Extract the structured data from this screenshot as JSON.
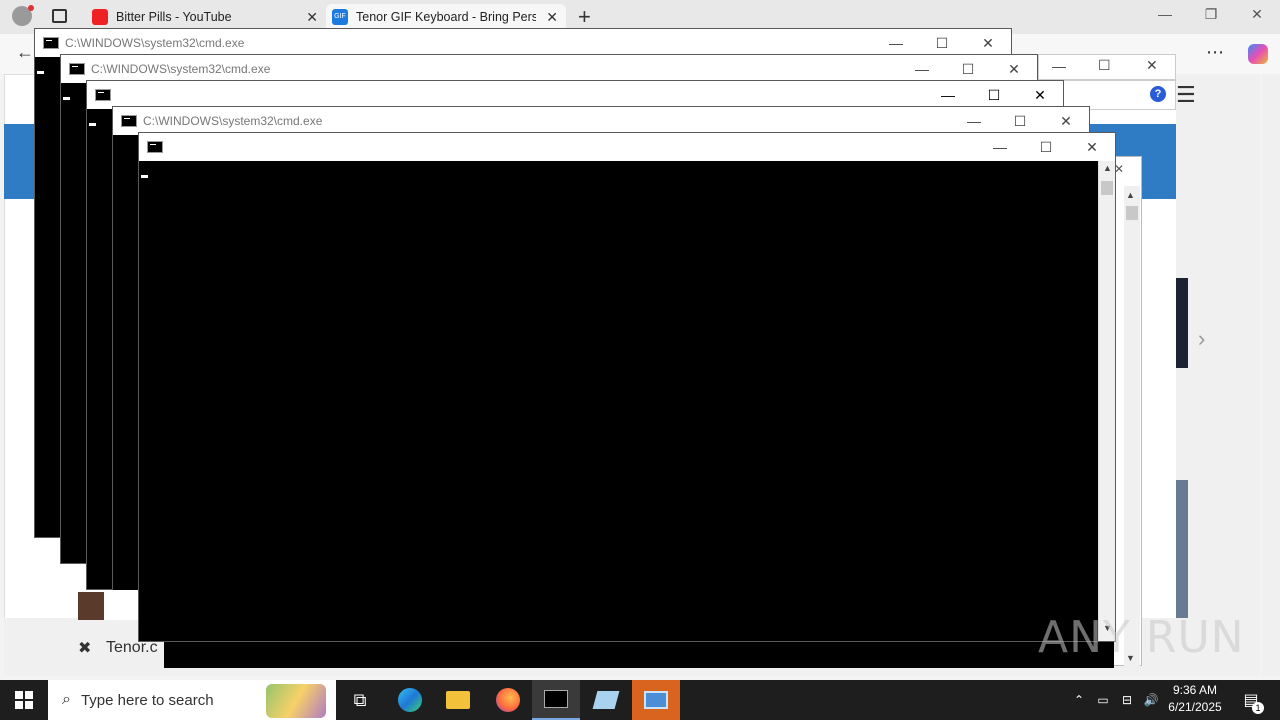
{
  "browser": {
    "tabs": [
      {
        "label": "Bitter Pills - YouTube"
      },
      {
        "label": "Tenor GIF Keyboard - Bring Perso"
      }
    ],
    "new_tab_symbol": "+",
    "bottom_tab_text": "Tenor.c"
  },
  "cmd_windows": [
    {
      "title": "C:\\WINDOWS\\system32\\cmd.exe"
    },
    {
      "title": "C:\\WINDOWS\\system32\\cmd.exe"
    },
    {
      "title": ""
    },
    {
      "title": "C:\\WINDOWS\\system32\\cmd.exe"
    },
    {
      "title": ""
    }
  ],
  "taskbar": {
    "search_placeholder": "Type here to search",
    "time": "9:36 AM",
    "date": "6/21/2025",
    "notification_count": "1"
  },
  "watermark": "ANY RUN",
  "colors": {
    "taskbar": "#1e1e1e",
    "accent_blue": "#2f7bc4",
    "console": "#000000"
  }
}
